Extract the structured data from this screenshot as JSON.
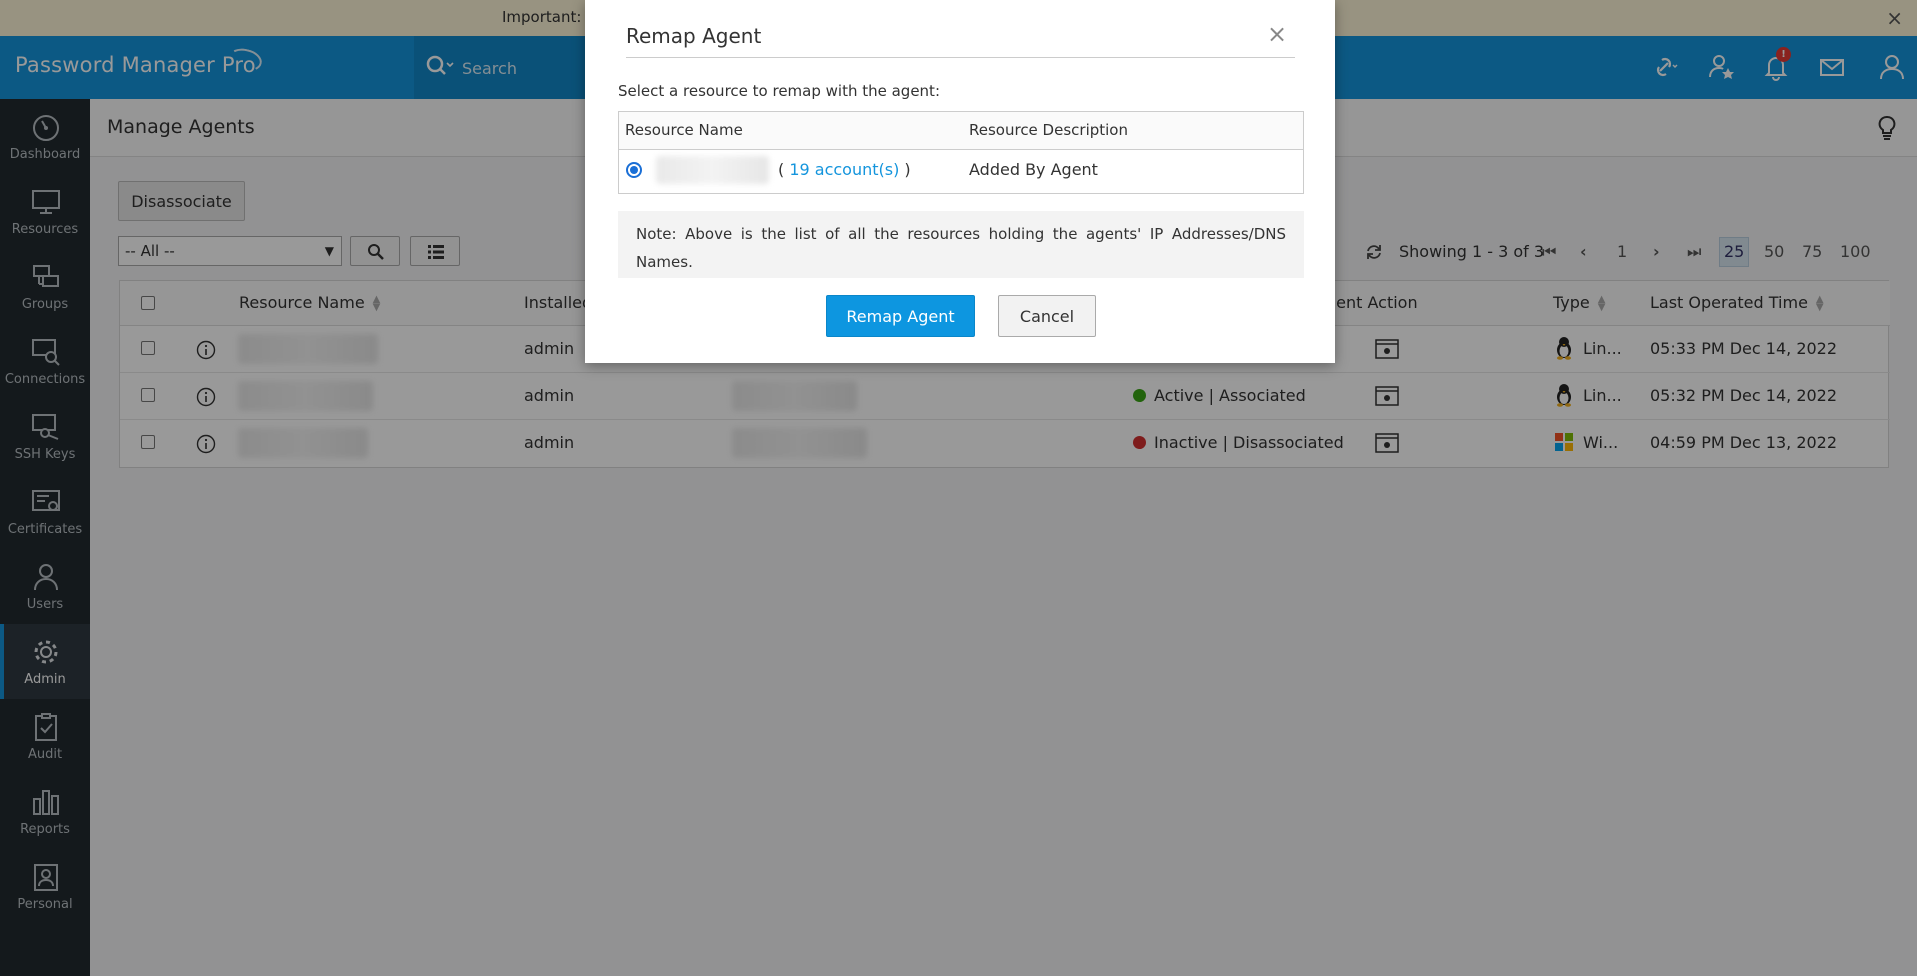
{
  "banner": {
    "text": "Important: M",
    "close": "×"
  },
  "header": {
    "logo": "Password Manager Pro",
    "search_placeholder": "Search",
    "notification_badge": "!"
  },
  "sidebar": {
    "items": [
      {
        "label": "Dashboard",
        "icon": "dashboard-icon"
      },
      {
        "label": "Resources",
        "icon": "monitor-icon"
      },
      {
        "label": "Groups",
        "icon": "groups-icon"
      },
      {
        "label": "Connections",
        "icon": "connections-icon"
      },
      {
        "label": "SSH Keys",
        "icon": "ssh-key-icon"
      },
      {
        "label": "Certificates",
        "icon": "certificate-icon"
      },
      {
        "label": "Users",
        "icon": "user-icon"
      },
      {
        "label": "Admin",
        "icon": "gear-icon",
        "active": true
      },
      {
        "label": "Audit",
        "icon": "clipboard-check-icon"
      },
      {
        "label": "Reports",
        "icon": "bar-chart-icon"
      },
      {
        "label": "Personal",
        "icon": "personal-icon"
      }
    ]
  },
  "page": {
    "title": "Manage Agents",
    "disassociate_label": "Disassociate",
    "filter_value": "-- All --",
    "showing": "Showing 1 - 3 of 3",
    "page_number": "1",
    "page_sizes": [
      "25",
      "50",
      "75",
      "100"
    ],
    "current_page_size": "25"
  },
  "table": {
    "headers": {
      "resource_name": "Resource Name",
      "installed": "Installed",
      "agent_action": "gent Action",
      "type": "Type",
      "last_operated": "Last Operated Time"
    },
    "rows": [
      {
        "installed_by": "admin",
        "status": "",
        "type": "Lin...",
        "os": "linux",
        "last_operated": "05:33 PM Dec 14, 2022"
      },
      {
        "installed_by": "admin",
        "status": "Active | Associated",
        "status_color": "#3aa614",
        "type": "Lin...",
        "os": "linux",
        "last_operated": "05:32 PM Dec 14, 2022"
      },
      {
        "installed_by": "admin",
        "status": "Inactive | Disassociated",
        "status_color": "#d32f2f",
        "type": "Wi...",
        "os": "windows",
        "last_operated": "04:59 PM Dec 13, 2022"
      }
    ]
  },
  "modal": {
    "title": "Remap Agent",
    "close": "×",
    "instruction": "Select a resource to remap with the agent:",
    "col_resource_name": "Resource Name",
    "col_resource_description": "Resource Description",
    "row": {
      "accounts_open": "( ",
      "accounts_link": "19 account(s)",
      "accounts_close": " )",
      "description": "Added By Agent"
    },
    "note": "Note: Above is the list of all the resources holding the agents' IP Addresses/DNS Names.",
    "remap_label": "Remap Agent",
    "cancel_label": "Cancel"
  },
  "colors": {
    "header_blue": "#1495dd",
    "sidebar_bg": "#222a2f",
    "primary_button": "#0d96e0",
    "active_status": "#3aa614",
    "inactive_status": "#d32f2f"
  }
}
